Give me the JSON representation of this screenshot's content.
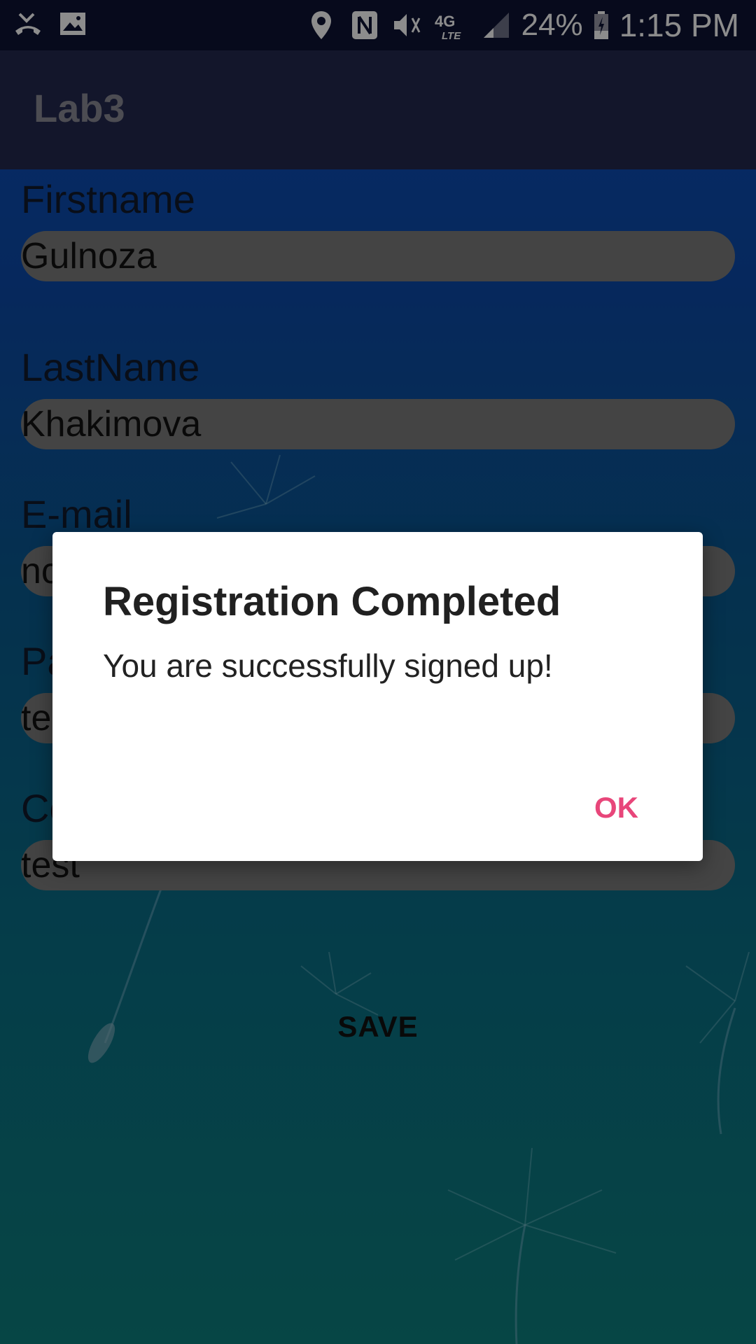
{
  "status_bar": {
    "icons_left": [
      "missed-call-icon",
      "image-icon"
    ],
    "icons_right": [
      "location-icon",
      "nfc-icon",
      "mute-icon",
      "lte-icon",
      "signal-icon",
      "battery-icon"
    ],
    "lte_label": "4G LTE",
    "battery": "24%",
    "time": "1:15 PM"
  },
  "app_bar": {
    "title": "Lab3"
  },
  "form": {
    "firstname_label": "Firstname",
    "firstname_value": "Gulnoza",
    "lastname_label": "LastName",
    "lastname_value": "Khakimova",
    "email_label": "E-mail",
    "email_value_visible": "nc",
    "password_label_visible": "Pa",
    "password_value_visible": "te",
    "confirm_label_visible": "Co",
    "confirm_value": "test",
    "save_label": "SAVE"
  },
  "dialog": {
    "title": "Registration Completed",
    "message": "You are successfully signed up!",
    "ok_label": "OK",
    "ok_color": "#e8467a"
  },
  "colors": {
    "status_bar": "#0d1333",
    "app_bar": "#23284f",
    "input_bg": "#7d7d7d"
  }
}
